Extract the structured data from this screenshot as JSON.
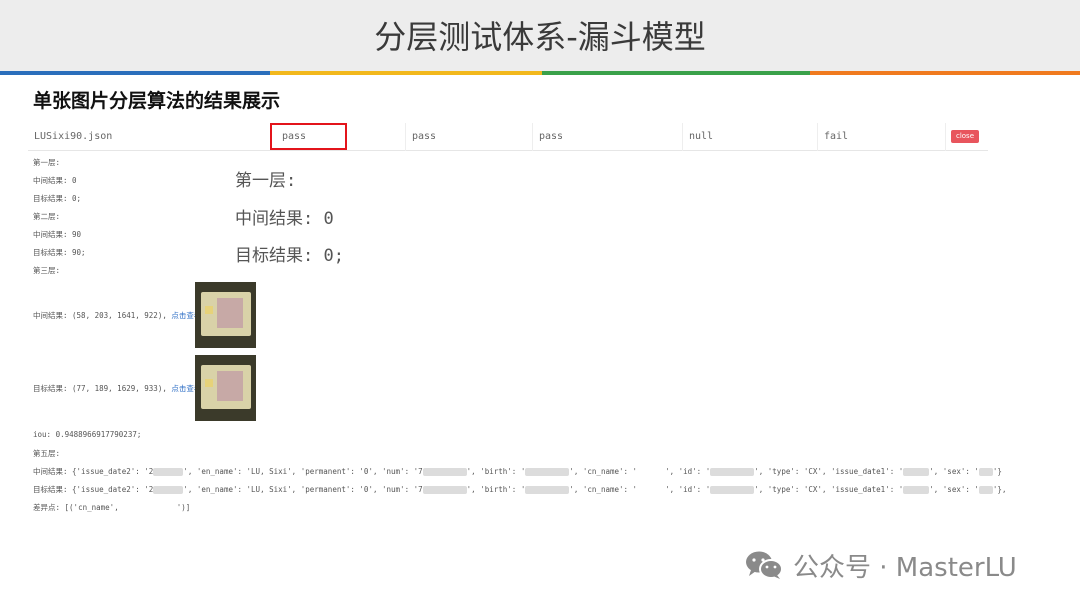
{
  "header": {
    "title": "分层测试体系-漏斗模型"
  },
  "stripe_colors": [
    "#2a6ebb",
    "#f2b81c",
    "#3aa14a",
    "#f07a1f"
  ],
  "section_title": "单张图片分层算法的结果展示",
  "result_row": {
    "file": "LUSixi90.json",
    "cells": [
      "pass",
      "pass",
      "pass",
      "null",
      "fail"
    ],
    "close_label": "close"
  },
  "left_panel": {
    "layer1": "第一层:",
    "mid1": "中间结果: 0",
    "target1": "目标结果: 0;",
    "layer2": "第二层:",
    "mid2": "中间结果: 90",
    "target2": "目标结果: 90;",
    "layer3": "第三层:",
    "mid3": "中间结果: (58, 203, 1641, 922),",
    "target3": "目标结果: (77, 189, 1629, 933),",
    "view_link": "点击查看",
    "iou": "iou: 0.9488966917790237;",
    "layer5": "第五层:",
    "mid5_a": "中间结果: {'issue_date2': '2",
    "mid5_b": "', 'en_name': 'LU, Sixi', 'permanent': '0', 'num': '7",
    "mid5_c": "', 'birth': '",
    "mid5_d": "', 'cn_name': '",
    "mid5_e": "', 'id': '",
    "mid5_f": "', 'type': 'CX', 'issue_date1': '",
    "mid5_g": "', 'sex': '",
    "mid5_h": "'}",
    "target5_a": "目标结果: {'issue_date2': '2",
    "target5_h": "'},",
    "diff_a": "差异点: [('cn_name',",
    "diff_b": "')]"
  },
  "zoom_panel": {
    "layer1": "第一层:",
    "mid1": "中间结果: 0",
    "target1": "目标结果: 0;"
  },
  "watermark": "公众号 · MasterLU"
}
